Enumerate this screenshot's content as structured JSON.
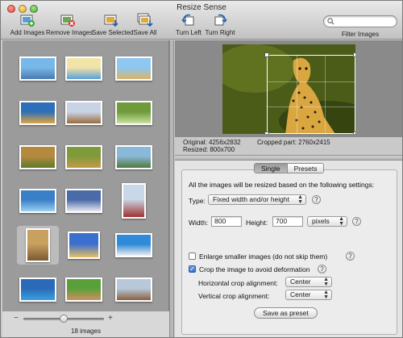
{
  "window": {
    "title": "Resize Sense"
  },
  "toolbar": {
    "add_images": "Add Images",
    "remove_images": "Remove Images",
    "save_selected": "Save Selected",
    "save_all": "Save All",
    "turn_left": "Turn Left",
    "turn_right": "Turn Right"
  },
  "search": {
    "placeholder": "",
    "label": "Filter Images"
  },
  "thumbnails": {
    "count_label": "18 images",
    "selected_index": 12
  },
  "preview": {
    "original_label": "Original: 4256x2832",
    "resized_label": "Resized: 800x700",
    "cropped_label": "Cropped part: 2760x2415"
  },
  "settings": {
    "tabs": [
      "Single",
      "Presets"
    ],
    "active_tab": "Single",
    "intro": "All the images will be resized based on the following settings:",
    "type_label": "Type:",
    "type_value": "Fixed width and/or height",
    "width_label": "Width:",
    "width_value": "800",
    "height_label": "Height:",
    "height_value": "700",
    "unit_value": "pixels",
    "enlarge_label": "Enlarge smaller images (do not skip them)",
    "enlarge_checked": false,
    "crop_label": "Crop the image to avoid deformation",
    "crop_checked": true,
    "h_align_label": "Horizontal crop alignment:",
    "h_align_value": "Center",
    "v_align_label": "Vertical crop alignment:",
    "v_align_value": "Center",
    "save_preset": "Save as preset",
    "help_symbol": "?"
  },
  "zoom": {
    "minus": "−",
    "plus": "+",
    "level": 0.5
  }
}
